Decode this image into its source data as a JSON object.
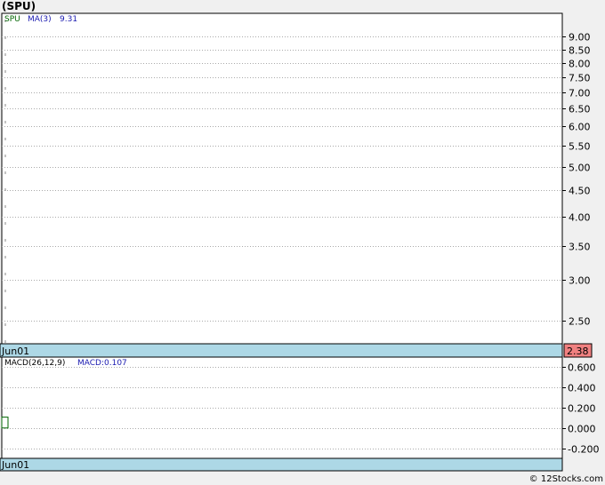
{
  "header": {
    "symbol_title": "(SPU)"
  },
  "upper_panel": {
    "legend_symbol": "SPU",
    "legend_ma_label": "MA(3)",
    "legend_ma_value": "9.31",
    "date_label": "Jun01",
    "last_price_badge": "2.38"
  },
  "lower_panel": {
    "legend_macd_params": "MACD(26,12,9)",
    "legend_macd_value": "MACD:0.107",
    "date_label": "Jun01"
  },
  "footer": {
    "copyright": "© 12Stocks.com"
  },
  "colors": {
    "background": "#f0f0f0",
    "plot_background": "#ffffff",
    "grid": "#aaaaaa",
    "date_bar": "#add8e6",
    "price_badge": "#f08080",
    "symbol_green": "#006400",
    "ma_blue": "#1a1ab0",
    "macd_bar": "#006400"
  },
  "chart_data": [
    {
      "type": "line",
      "scale": "log",
      "ylim": [
        2.25,
        10.0
      ],
      "yticks": [
        9.0,
        8.5,
        8.0,
        7.5,
        7.0,
        6.5,
        6.0,
        5.5,
        5.0,
        4.5,
        4.0,
        3.5,
        3.0,
        2.5
      ],
      "ytick_labels": [
        "9.00",
        "8.50",
        "8.00",
        "7.50",
        "7.00",
        "6.50",
        "6.00",
        "5.50",
        "5.00",
        "4.50",
        "4.00",
        "3.50",
        "3.00",
        "2.50"
      ],
      "categories": [
        "Jun01"
      ],
      "last_value": 2.38,
      "series": [
        {
          "name": "SPU",
          "values": []
        },
        {
          "name": "MA(3)",
          "values": [
            9.31
          ]
        }
      ],
      "grid": true
    },
    {
      "type": "bar",
      "ylim": [
        -0.3,
        0.7
      ],
      "yticks": [
        0.6,
        0.4,
        0.2,
        0.0,
        -0.2
      ],
      "ytick_labels": [
        "0.600",
        "0.400",
        "0.200",
        "0.000",
        "-0.200"
      ],
      "categories": [
        "Jun01"
      ],
      "series": [
        {
          "name": "MACD(26,12,9)",
          "values": [
            0.107
          ]
        }
      ],
      "grid": true
    }
  ]
}
